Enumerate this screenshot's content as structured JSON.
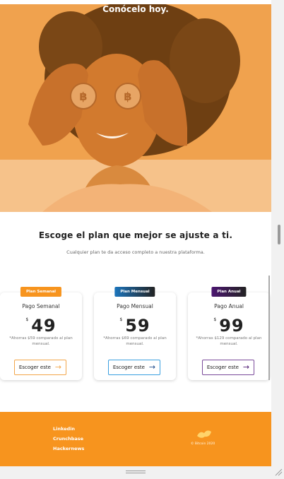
{
  "hero": {
    "title": "Conócelo hoy."
  },
  "plans": {
    "title": "Escoge el plan que mejor se ajuste a ti.",
    "subtitle": "Cualquier plan te da acceso completo a nuestra plataforma.",
    "cards": [
      {
        "badge": "Plan Semanal",
        "name": "Pago Semanal",
        "currency": "$",
        "price": "49",
        "saving_line1": "*Ahorras $59 comparado al plan",
        "saving_line2": "mensual.",
        "button": "Escoger este",
        "badge_color": "#f7941e",
        "button_border": "#f2a64a"
      },
      {
        "badge": "Plan Mensual",
        "name": "Pago Mensual",
        "currency": "$",
        "price": "59",
        "saving_line1": "*Ahorras $69 comparado al plan",
        "saving_line2": "mensual.",
        "button": "Escoger este",
        "badge_color": "#1c75bc",
        "button_border": "#3aa0e0"
      },
      {
        "badge": "Plan Anual",
        "name": "Pago Anual",
        "currency": "$",
        "price": "99",
        "saving_line1": "*Ahorras $129 comparado al plan",
        "saving_line2": "mensual.",
        "button": "Escoger este",
        "badge_color": "#4b1670",
        "button_border": "#7a4a9a"
      }
    ]
  },
  "footer": {
    "links": [
      "Linkedin",
      "Crunchbase",
      "Hackernews"
    ],
    "copyright": "© Bitcoin 2020"
  }
}
